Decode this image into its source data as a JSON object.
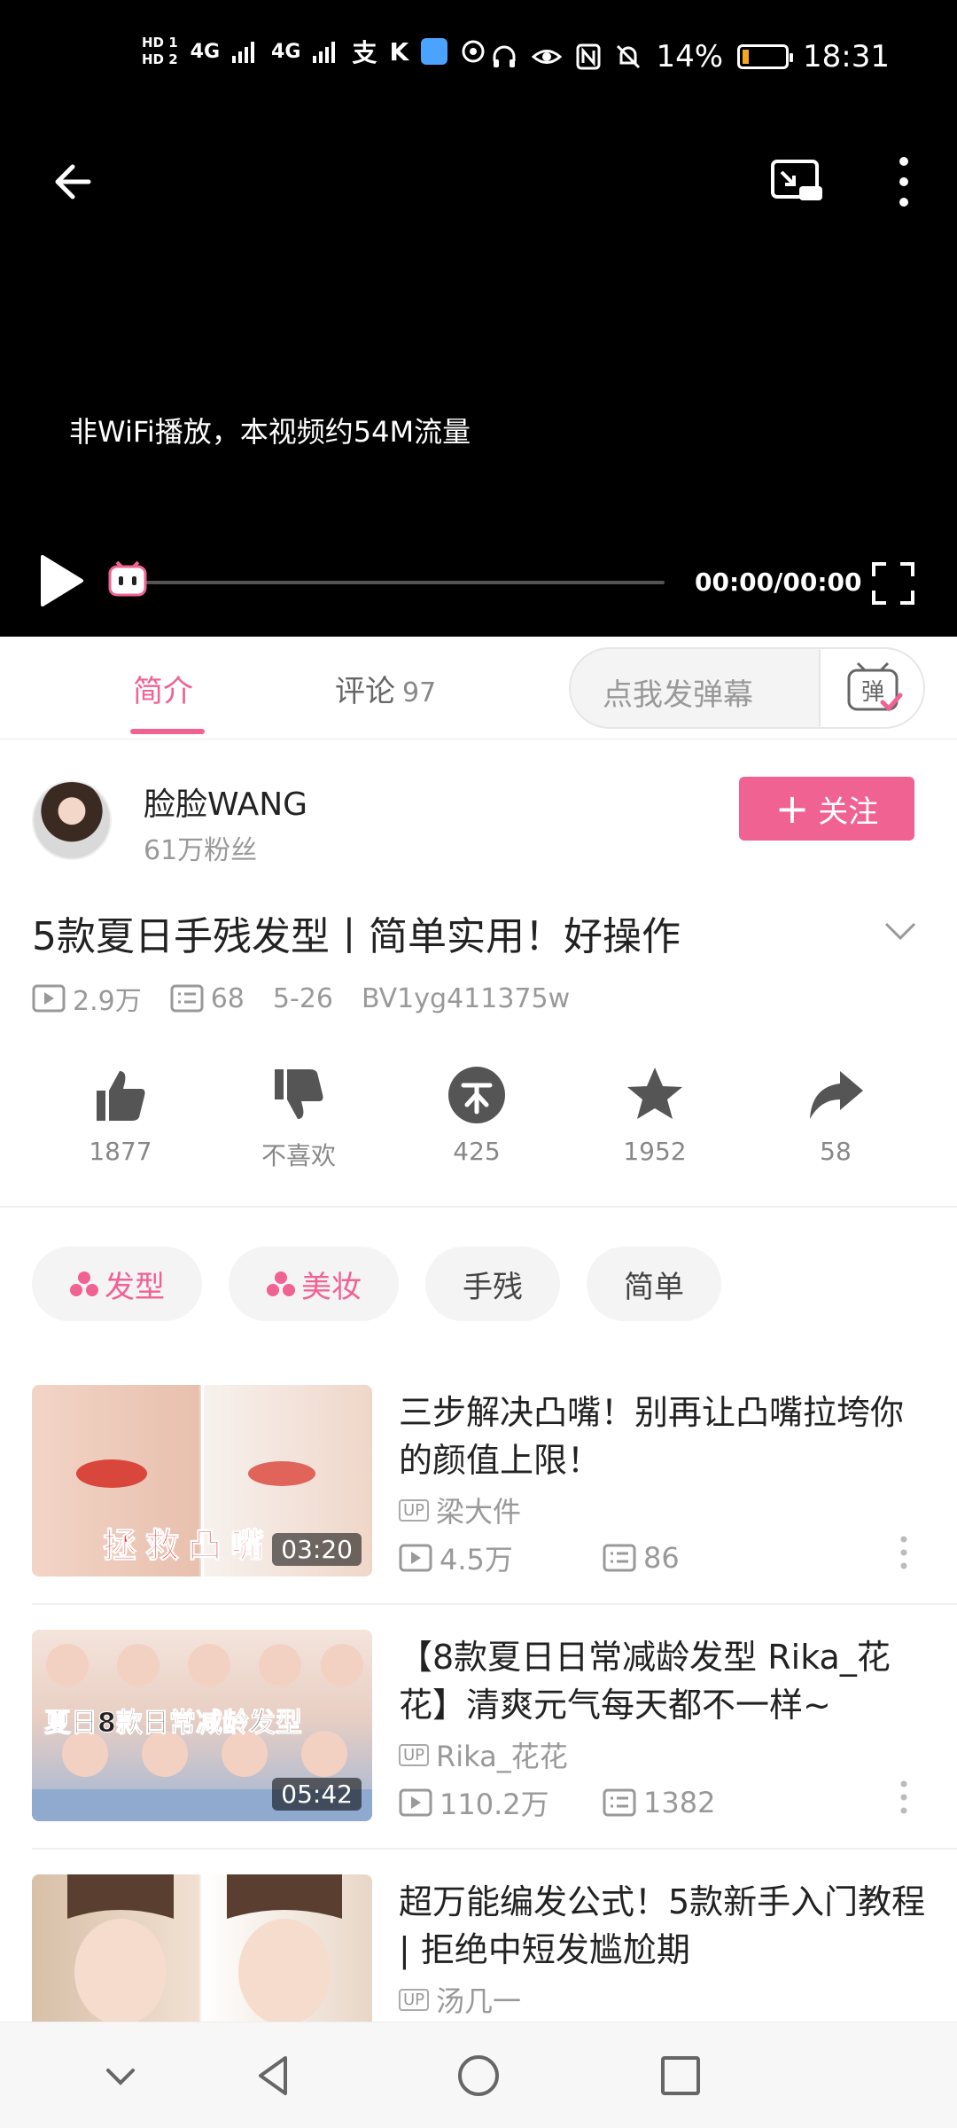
{
  "status_bar": {
    "hd1": "HD 1",
    "hd2": "HD 2",
    "signal1": "4G",
    "signal2": "4G",
    "battery_pct": "14%",
    "battery_level": 0.14,
    "time": "18:31"
  },
  "video": {
    "notice": "非WiFi播放，本视频约54M流量",
    "time": "00:00/00:00",
    "progress": 0
  },
  "tabs": {
    "intro": "简介",
    "comments": "评论",
    "comments_count": "97",
    "danmaku_placeholder": "点我发弹幕",
    "danmaku_button": "弹"
  },
  "uploader": {
    "name": "脸脸WANG",
    "fans": "61万粉丝",
    "follow_label": "关注"
  },
  "video_info": {
    "title": "5款夏日手残发型丨简单实用！好操作",
    "views": "2.9万",
    "danmaku_count": "68",
    "date": "5-26",
    "bvid": "BV1yg411375w"
  },
  "actions": {
    "like": "1877",
    "dislike": "不喜欢",
    "coin": "425",
    "favorite": "1952",
    "share": "58"
  },
  "tags": [
    "发型",
    "美妆",
    "手残",
    "简单"
  ],
  "related": [
    {
      "title": "三步解决凸嘴！别再让凸嘴拉垮你的颜值上限！",
      "thumb_text": "拯救凸嘴",
      "duration": "03:20",
      "up": "梁大件",
      "views": "4.5万",
      "danmaku": "86"
    },
    {
      "title": "【8款夏日日常减龄发型 Rika_花花】清爽元气每天都不一样~",
      "thumb_text": "夏日8款日常减龄发型",
      "duration": "05:42",
      "up": "Rika_花花",
      "views": "110.2万",
      "danmaku": "1382"
    },
    {
      "title": "超万能编发公式！5款新手入门教程 | 拒绝中短发尴尬期",
      "up": "汤几一"
    }
  ],
  "up_badge": "UP",
  "colors": {
    "accent": "#f06292",
    "video_bg": "#000000",
    "muted_text": "#999999"
  }
}
